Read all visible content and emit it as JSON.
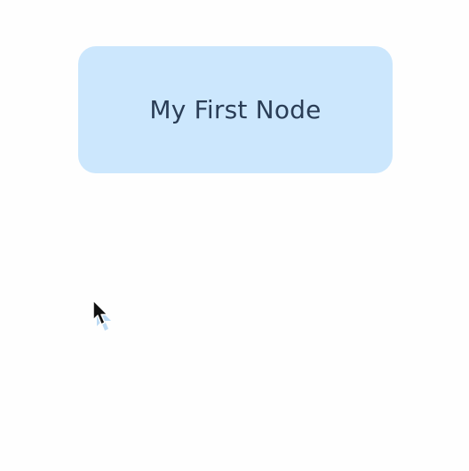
{
  "canvas": {
    "background": "#fefefe"
  },
  "node": {
    "label": "My First Node",
    "fill_color": "#cce7fd",
    "text_color": "#2a3d56"
  },
  "cursor": {
    "icon": "arrow-pointer-icon"
  }
}
